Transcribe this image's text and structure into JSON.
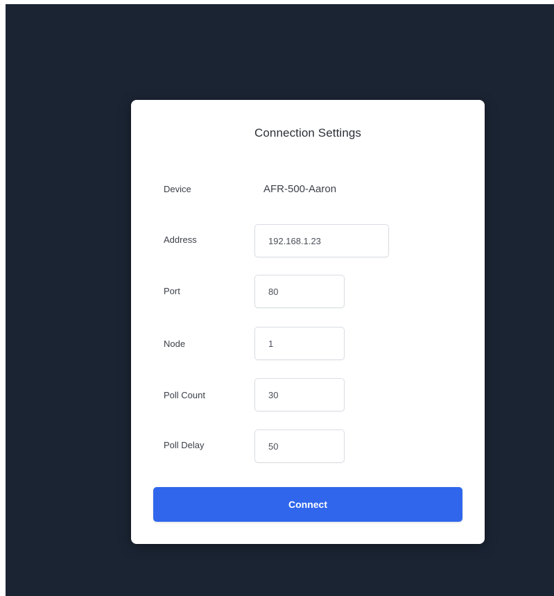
{
  "dialog": {
    "title": "Connection Settings",
    "device": {
      "label": "Device",
      "value": "AFR-500-Aaron"
    },
    "fields": {
      "address": {
        "label": "Address",
        "value": "192.168.1.23"
      },
      "port": {
        "label": "Port",
        "value": "80"
      },
      "node": {
        "label": "Node",
        "value": "1"
      },
      "poll_count": {
        "label": "Poll Count",
        "value": "30"
      },
      "poll_delay": {
        "label": "Poll Delay",
        "value": "50"
      }
    },
    "connect_label": "Connect"
  },
  "colors": {
    "background": "#1b2433",
    "dialog": "#ffffff",
    "primary_button": "#2f66ec"
  }
}
